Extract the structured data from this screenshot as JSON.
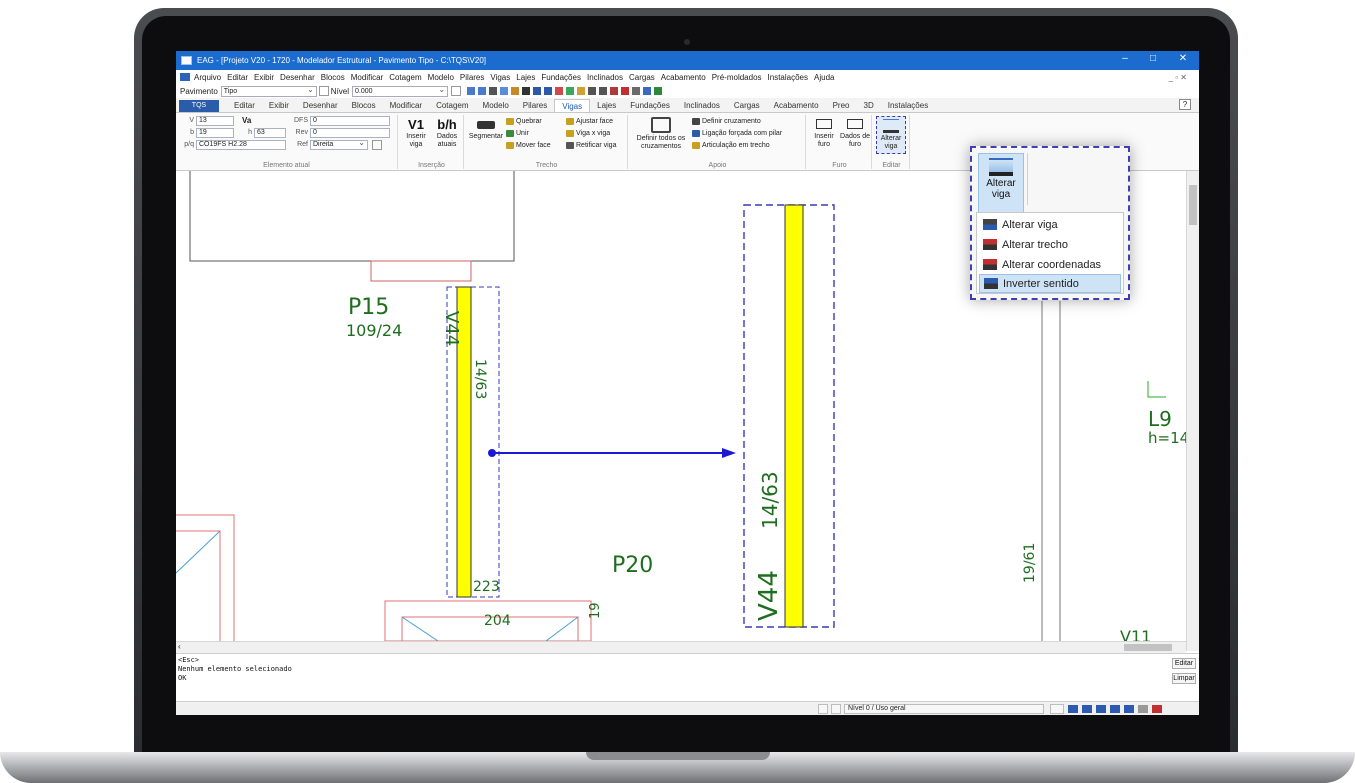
{
  "window": {
    "title": "EAG - [Projeto V20 - 1720 - Modelador Estrutural - Pavimento Tipo - C:\\TQS\\V20]",
    "min": "–",
    "max": "□",
    "close": "✕",
    "inner_controls": "_ ▫ ✕"
  },
  "menu": [
    "Arquivo",
    "Editar",
    "Exibir",
    "Desenhar",
    "Blocos",
    "Modificar",
    "Cotagem",
    "Modelo",
    "Pilares",
    "Vigas",
    "Lajes",
    "Fundações",
    "Inclinados",
    "Cargas",
    "Acabamento",
    "Pré-moldados",
    "Instalações",
    "Ajuda"
  ],
  "toolbar": {
    "pavimento_label": "Pavimento",
    "pavimento_value": "Tipo",
    "nivel_label": "Nível",
    "nivel_value": "0.000"
  },
  "tabs": [
    "Editar",
    "Exibir",
    "Desenhar",
    "Blocos",
    "Modificar",
    "Cotagem",
    "Modelo",
    "Pilares",
    "Vigas",
    "Lajes",
    "Fundações",
    "Inclinados",
    "Cargas",
    "Acabamento",
    "Preo",
    "3D",
    "Instalações"
  ],
  "active_tab": "Vigas",
  "file_tab": "TQS",
  "ribbon": {
    "elemento_atual": {
      "name": "Elemento atual",
      "v_label": "V",
      "v_value": "13",
      "v_extra": "Va",
      "b_label": "b",
      "b_value": "19",
      "h_label": "h",
      "h_value": "63",
      "pq_label": "p/q",
      "pq_value": "CO19FS H2.28",
      "dfs_label": "DFS",
      "dfs_value": "0",
      "rev_label": "Rev",
      "rev_value": "0",
      "ref_label": "Ref",
      "ref_value": "Direita"
    },
    "insercao": {
      "name": "Inserção",
      "inserir_viga": "Inserir viga",
      "inserir_icon": "V1",
      "dados_atuais": "Dados atuais",
      "dados_icon": "b/h"
    },
    "trecho": {
      "name": "Trecho",
      "segmentar": "Segmentar",
      "quebrar": "Quebrar",
      "unir": "Unir",
      "mover_face": "Mover face",
      "ajustar_face": "Ajustar face",
      "viga_x_viga": "Viga x viga",
      "retificar_viga": "Retificar viga"
    },
    "apoio": {
      "name": "Apoio",
      "definir_todos": "Definir todos os cruzamentos",
      "definir_cruzamento": "Definir cruzamento",
      "ligacao_forcada": "Ligação forçada com pilar",
      "articulacao": "Articulação em trecho"
    },
    "furo": {
      "name": "Furo",
      "inserir_furo": "Inserir furo",
      "dados_furo": "Dados de furo"
    },
    "editar": {
      "name": "Editar",
      "alterar_viga": "Alterar viga"
    }
  },
  "drawing": {
    "p15_name": "P15",
    "p15_dim": "109/24",
    "v44_label_left": "V44",
    "v44_dim_left": "14/63",
    "v44_label_right": "V44",
    "v44_dim_right": "14/63",
    "p20_name": "P20",
    "dim_223": "223",
    "dim_204": "204",
    "dim_19": "19",
    "dim_19_61": "19/61",
    "l9_name": "L9",
    "l9_h": "h=14",
    "v11_partial": "V11"
  },
  "popup": {
    "alterar_viga_button": "Alterar viga",
    "items": [
      "Alterar viga",
      "Alterar trecho",
      "Alterar coordenadas",
      "Inverter sentido"
    ],
    "selected": "Inverter sentido"
  },
  "console": {
    "lines": [
      "<Esc>",
      "Nenhum elemento selecionado",
      "OK"
    ],
    "editar_button": "Editar",
    "limpar_button": "Limpar"
  },
  "status": {
    "nivel_text": "Nível 0 / Uso geral"
  },
  "colors": {
    "beam_fill": "#ffff00",
    "dashed_selection": "#3a3ab8",
    "arrow": "#1a1ad6",
    "green_text": "#1f6e1f",
    "pink_lines": "#e07070"
  }
}
